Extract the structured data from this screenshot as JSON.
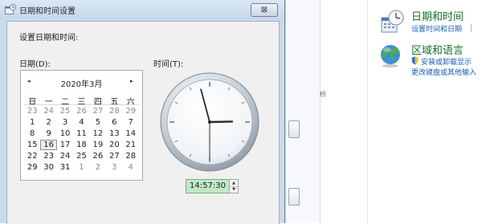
{
  "dialog": {
    "title": "日期和时间设置",
    "close_symbol": "⊠",
    "heading": "设置日期和时间:",
    "date_label": "日期(D):",
    "time_label": "时间(T):"
  },
  "calendar": {
    "prev_symbol": "◂",
    "next_symbol": "▸",
    "month_title": "2020年3月",
    "weekdays": [
      "日",
      "一",
      "二",
      "三",
      "四",
      "五",
      "六"
    ],
    "weeks": [
      [
        "23",
        "24",
        "25",
        "26",
        "27",
        "28",
        "29"
      ],
      [
        "1",
        "2",
        "3",
        "4",
        "5",
        "6",
        "7"
      ],
      [
        "8",
        "9",
        "10",
        "11",
        "12",
        "13",
        "14"
      ],
      [
        "15",
        "16",
        "17",
        "18",
        "19",
        "20",
        "21"
      ],
      [
        "22",
        "23",
        "24",
        "25",
        "26",
        "27",
        "28"
      ],
      [
        "29",
        "30",
        "31",
        "1",
        "2",
        "3",
        "4"
      ]
    ],
    "selected_day": "16"
  },
  "clock": {
    "hour": 14,
    "minute": 57,
    "second": 30
  },
  "time_field": {
    "value": "14:57:30",
    "spin_up": "▲",
    "spin_down": "▼"
  },
  "background_panel": {
    "side_glyph": "桥",
    "datetime": {
      "title": "日期和时间",
      "link": "设置时间和日期",
      "icon": "clock-calendar-icon"
    },
    "region": {
      "title": "区域和语言",
      "link1": "安装或卸载显示",
      "link2": "更改键盘或其他输入",
      "icon": "globe-icon"
    }
  },
  "colors": {
    "accent_green": "#1a6f2a",
    "link_blue": "#1a5fb4",
    "time_highlight": "#c2e8c4"
  }
}
